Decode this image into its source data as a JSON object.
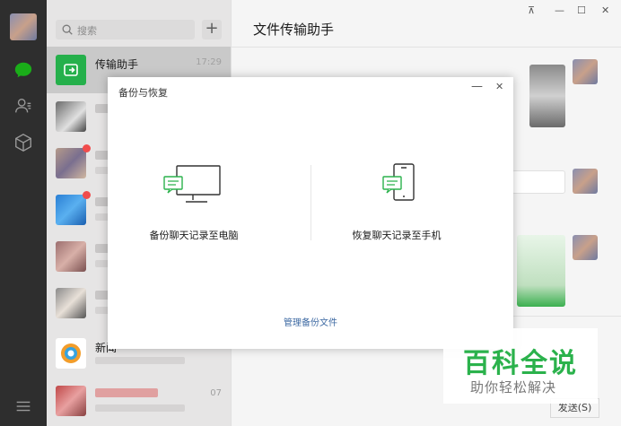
{
  "sidebar": {
    "icons": [
      "avatar",
      "chat-icon",
      "contacts-icon",
      "favorites-icon",
      "menu-icon"
    ],
    "accent": "#1aad19"
  },
  "list": {
    "search_placeholder": "搜索",
    "add_label": "+",
    "items": [
      {
        "name": "传输助手",
        "time": "17:29",
        "selected": true
      },
      {
        "name": "",
        "time": ""
      },
      {
        "name": "",
        "time": ""
      },
      {
        "name": "",
        "time": ""
      },
      {
        "name": "",
        "time": ""
      },
      {
        "name": "",
        "time": ""
      },
      {
        "name": "新闻",
        "time": ""
      },
      {
        "name": "",
        "time": "07"
      }
    ]
  },
  "main": {
    "title": "文件传输助手",
    "window_controls": [
      "⊼",
      "—",
      "☐",
      "✕"
    ],
    "send_label": "发送(S)"
  },
  "modal": {
    "title": "备份与恢复",
    "minimize": "—",
    "close": "✕",
    "option_backup": "备份聊天记录至电脑",
    "option_restore": "恢复聊天记录至手机",
    "manage_link": "管理备份文件"
  },
  "watermark": {
    "big": "百科全说",
    "small": "助你轻松解决"
  }
}
